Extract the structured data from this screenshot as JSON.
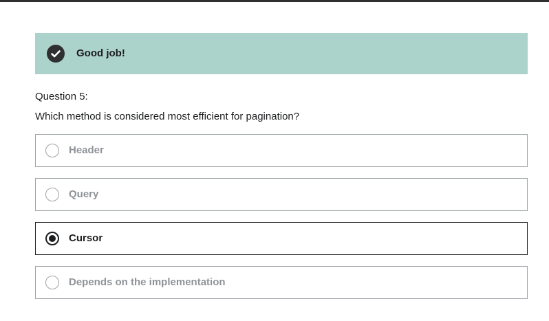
{
  "feedback": {
    "icon": "check-circle-icon",
    "message": "Good job!",
    "background_color": "#acd2cc"
  },
  "question": {
    "number_label": "Question 5:",
    "text": "Which method is considered most efficient for pagination?"
  },
  "answers": [
    {
      "label": "Header",
      "selected": false
    },
    {
      "label": "Query",
      "selected": false
    },
    {
      "label": "Cursor",
      "selected": true
    },
    {
      "label": "Depends on the implementation",
      "selected": false
    }
  ]
}
